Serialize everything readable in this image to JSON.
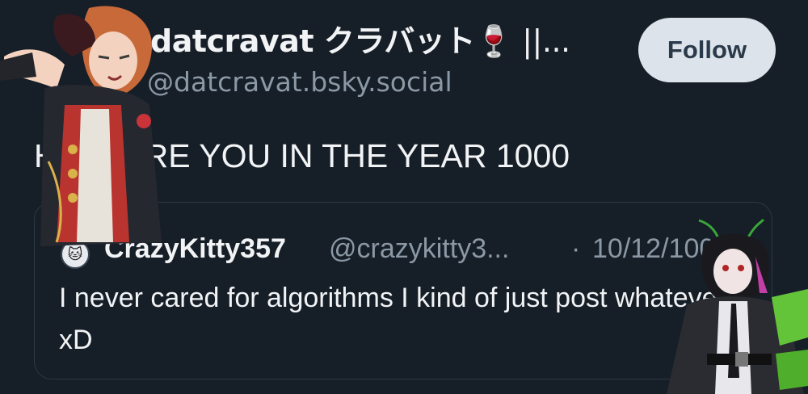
{
  "post": {
    "author": {
      "display_name": "datcravat クラバット",
      "display_name_suffix": "🍷 ||...",
      "handle": "@datcravat.bsky.social"
    },
    "follow_label": "Follow",
    "text": "HOW ARE YOU IN THE YEAR 1000",
    "quote": {
      "avatar_icon": "cat-face-icon",
      "author_name": "CrazyKitty357",
      "author_handle": "@crazykitty3...",
      "separator": "·",
      "date": "10/12/1000",
      "text": "I never cared for algorithms I kind of just post whatever xD"
    }
  },
  "colors": {
    "background": "#161e27",
    "primary_text": "#f1f3f5",
    "secondary_text": "#8b98a5",
    "follow_button_bg": "#dce3ea",
    "follow_button_text": "#2b3a4a",
    "quote_border": "#2c3946"
  }
}
